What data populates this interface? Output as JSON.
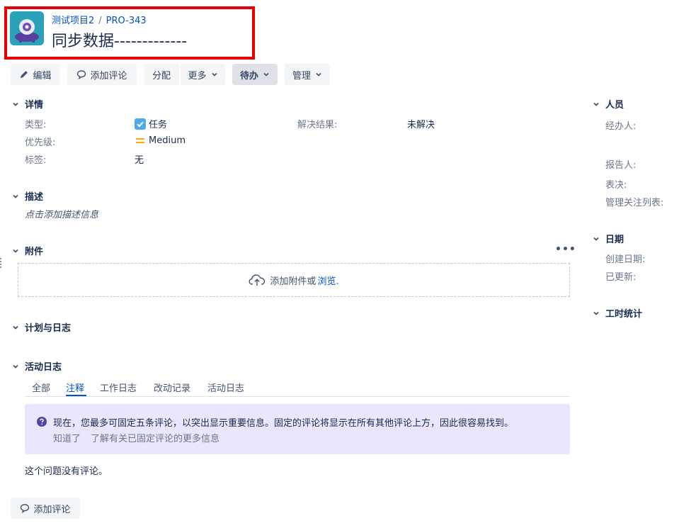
{
  "breadcrumb": {
    "project": "测试项目2",
    "separator": "/",
    "issue_key": "PRO-343"
  },
  "issue": {
    "title": "同步数据-------------"
  },
  "toolbar": {
    "edit": "编辑",
    "comment": "添加评论",
    "assign": "分配",
    "more": "更多",
    "status": "待办",
    "admin": "管理"
  },
  "details": {
    "heading": "详情",
    "type_label": "类型:",
    "type_value": "任务",
    "priority_label": "优先级:",
    "priority_value": "Medium",
    "labels_label": "标签:",
    "labels_value": "无",
    "resolution_label": "解决结果:",
    "resolution_value": "未解决"
  },
  "description": {
    "heading": "描述",
    "placeholder": "点击添加描述信息"
  },
  "attachments": {
    "heading": "附件",
    "more": "•••",
    "drop_text": "添加附件或",
    "browse": "浏览."
  },
  "planning": {
    "heading": "计划与日志"
  },
  "activity": {
    "heading": "活动日志",
    "tabs": [
      "全部",
      "注释",
      "工作日志",
      "改动记录",
      "活动日志"
    ],
    "active_tab": "注释",
    "notice_text": "现在，您最多可固定五条评论，以突出显示重要信息。固定的评论将显示在所有其他评论上方，因此很容易找到。",
    "notice_dismiss": "知道了",
    "notice_learn": "了解有关已固定评论的更多信息",
    "empty": "这个问题没有评论。",
    "add_comment": "添加评论"
  },
  "people": {
    "heading": "人员",
    "assignee_label": "经办人:",
    "reporter_label": "报告人:",
    "vote_label": "表决:",
    "watchers_label": "管理关注列表:"
  },
  "dates": {
    "heading": "日期",
    "created_label": "创建日期:",
    "updated_label": "已更新:"
  },
  "time_tracking": {
    "heading": "工时统计"
  },
  "colors": {
    "link": "#0052cc",
    "highlight": "#e60000",
    "notice_bg": "#eae6ff",
    "task_icon": "#4bade8",
    "priority_medium": "#ffab00"
  }
}
